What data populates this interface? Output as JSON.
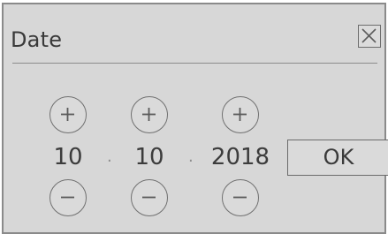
{
  "dialog": {
    "title": "Date",
    "close_icon": "close-icon",
    "ok_label": "OK"
  },
  "date": {
    "day": "10",
    "month": "10",
    "year": "2018",
    "separator": "."
  },
  "icons": {
    "increment": "plus-icon",
    "decrement": "minus-icon"
  }
}
